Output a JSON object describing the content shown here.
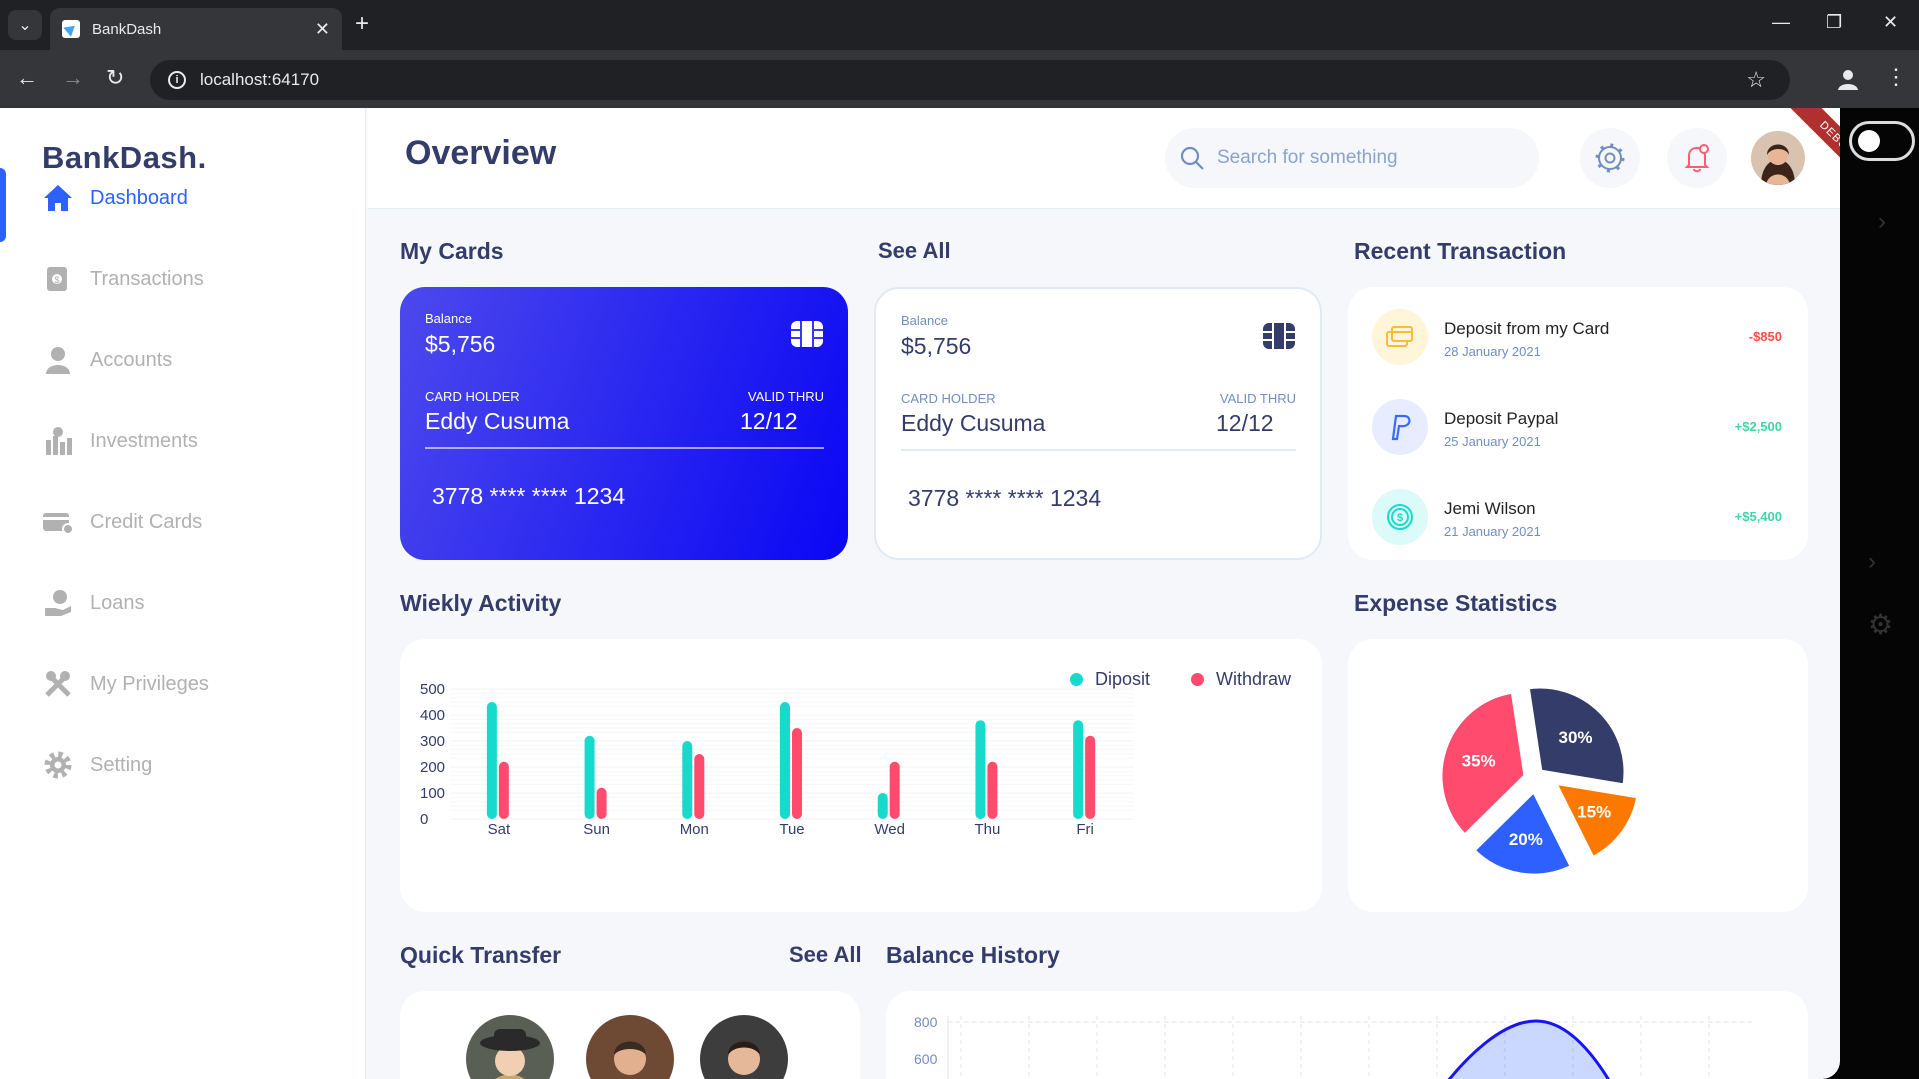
{
  "browser": {
    "tab_title": "BankDash",
    "url": "localhost:64170"
  },
  "app": {
    "logo": "BankDash.",
    "page_title": "Overview",
    "debug_banner": "DEBUG",
    "search": {
      "placeholder": "Search for something"
    }
  },
  "sidebar": {
    "items": [
      {
        "label": "Dashboard",
        "icon": "home-icon"
      },
      {
        "label": "Transactions",
        "icon": "transfer-icon"
      },
      {
        "label": "Accounts",
        "icon": "user-icon"
      },
      {
        "label": "Investments",
        "icon": "investment-icon"
      },
      {
        "label": "Credit Cards",
        "icon": "credit-card-icon"
      },
      {
        "label": "Loans",
        "icon": "loan-icon"
      },
      {
        "label": "My Privileges",
        "icon": "tools-icon"
      },
      {
        "label": "Setting",
        "icon": "gear-icon"
      }
    ]
  },
  "sections": {
    "my_cards": "My Cards",
    "see_all": "See All",
    "recent_transaction": "Recent Transaction",
    "weekly_activity": "Wiekly Activity",
    "expense_statistics": "Expense Statistics",
    "quick_transfer": "Quick Transfer",
    "quick_transfer_see_all": "See All",
    "balance_history": "Balance History"
  },
  "cards": [
    {
      "balance_label": "Balance",
      "balance": "$5,756",
      "holder_label": "CARD HOLDER",
      "holder": "Eddy Cusuma",
      "valid_label": "VALID THRU",
      "valid": "12/12",
      "number": "3778 **** **** 1234",
      "style": "blue"
    },
    {
      "balance_label": "Balance",
      "balance": "$5,756",
      "holder_label": "CARD HOLDER",
      "holder": "Eddy Cusuma",
      "valid_label": "VALID THRU",
      "valid": "12/12",
      "number": "3778 **** **** 1234",
      "style": "white"
    }
  ],
  "transactions": [
    {
      "title": "Deposit from my Card",
      "date": "28 January 2021",
      "amount": "-$850",
      "icon": "card-icon"
    },
    {
      "title": "Deposit Paypal",
      "date": "25 January 2021",
      "amount": "+$2,500",
      "icon": "paypal-icon"
    },
    {
      "title": "Jemi Wilson",
      "date": "21 January 2021",
      "amount": "+$5,400",
      "icon": "dollar-icon"
    }
  ],
  "colors": {
    "accent": "#2d60ff",
    "deposit": "#16dbcc",
    "withdraw": "#ff4b6e",
    "pie_navy": "#343c6a",
    "pie_orange": "#fc7900",
    "pie_blue": "#2d60ff",
    "pie_pink": "#ff4b6e"
  },
  "chart_data": [
    {
      "type": "bar",
      "categories": [
        "Sat",
        "Sun",
        "Mon",
        "Tue",
        "Wed",
        "Thu",
        "Fri"
      ],
      "series": [
        {
          "name": "Diposit",
          "values": [
            450,
            320,
            300,
            450,
            100,
            380,
            380
          ]
        },
        {
          "name": "Withdraw",
          "values": [
            220,
            120,
            250,
            350,
            220,
            220,
            320
          ]
        }
      ],
      "yticks": [
        0,
        100,
        200,
        300,
        400,
        500
      ],
      "ylim": [
        0,
        500
      ]
    },
    {
      "type": "pie",
      "slices": [
        {
          "label": "30%",
          "value": 30
        },
        {
          "label": "15%",
          "value": 15
        },
        {
          "label": "20%",
          "value": 20
        },
        {
          "label": "35%",
          "value": 35
        }
      ]
    },
    {
      "type": "area",
      "yticks": [
        800,
        600
      ]
    }
  ]
}
